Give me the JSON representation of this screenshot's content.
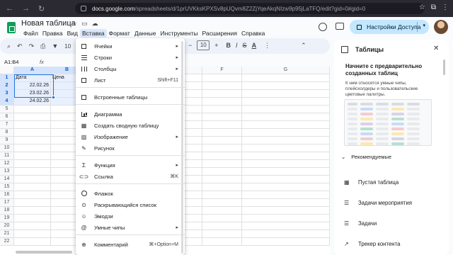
{
  "browser": {
    "back": "←",
    "forward": "→",
    "reload": "↻",
    "url_host": "docs.google.com",
    "url_path": "/spreadsheets/d/1prUVKksKPXSv8pUQvm8Z2ZjYqeAkqNIzw9p95jLaTFQ/edit?gid=0#gid=0",
    "star": "☆",
    "ext": "⧉",
    "menu": "⋮"
  },
  "app": {
    "title": "Новая таблица",
    "title_icons": [
      "☆",
      "▭",
      "☁"
    ],
    "menu": [
      "Файл",
      "Правка",
      "Вид",
      "Вставка",
      "Формат",
      "Данные",
      "Инструменты",
      "Расширения",
      "Справка"
    ],
    "active_menu_index": 3,
    "share_label": "Настройки Доступа",
    "share_caret": "▾"
  },
  "toolbar": {
    "icons": [
      "⌕",
      "↶",
      "↷",
      "⎙",
      "▼"
    ],
    "zoom": "10",
    "font_size": "10",
    "minus": "−",
    "plus": "+",
    "bold": "B",
    "italic": "I",
    "strike": "S",
    "color": "A",
    "more": "⋮",
    "collapse": "⌃"
  },
  "formula": {
    "namebox": "A1:B4",
    "fx": "fx"
  },
  "grid": {
    "columns": [
      "",
      "A",
      "B",
      "C",
      "D",
      "E",
      "F",
      "G"
    ],
    "rows": [
      {
        "num": "1",
        "cells": [
          "Дата",
          "Цена"
        ]
      },
      {
        "num": "2",
        "cells": [
          "22.02.26",
          ""
        ]
      },
      {
        "num": "3",
        "cells": [
          "23.02.26",
          ""
        ]
      },
      {
        "num": "4",
        "cells": [
          "24.02.26",
          ""
        ]
      },
      {
        "num": "5",
        "cells": [
          "",
          ""
        ]
      },
      {
        "num": "6",
        "cells": [
          "",
          ""
        ]
      },
      {
        "num": "7",
        "cells": [
          "",
          ""
        ]
      },
      {
        "num": "8",
        "cells": [
          "",
          ""
        ]
      },
      {
        "num": "9",
        "cells": [
          "",
          ""
        ]
      },
      {
        "num": "10",
        "cells": [
          "",
          ""
        ]
      },
      {
        "num": "11",
        "cells": [
          "",
          ""
        ]
      },
      {
        "num": "12",
        "cells": [
          "",
          ""
        ]
      },
      {
        "num": "13",
        "cells": [
          "",
          ""
        ]
      },
      {
        "num": "14",
        "cells": [
          "",
          ""
        ]
      },
      {
        "num": "15",
        "cells": [
          "",
          ""
        ]
      },
      {
        "num": "16",
        "cells": [
          "",
          ""
        ]
      },
      {
        "num": "17",
        "cells": [
          "",
          ""
        ]
      },
      {
        "num": "18",
        "cells": [
          "",
          ""
        ]
      },
      {
        "num": "19",
        "cells": [
          "",
          ""
        ]
      },
      {
        "num": "20",
        "cells": [
          "",
          ""
        ]
      },
      {
        "num": "21",
        "cells": [
          "",
          ""
        ]
      },
      {
        "num": "22",
        "cells": [
          "",
          ""
        ]
      }
    ]
  },
  "insert_menu": {
    "items": [
      {
        "label": "Ячейки",
        "right": "▸",
        "icon": "box-icon"
      },
      {
        "label": "Строки",
        "right": "▸",
        "icon": "rows-icon"
      },
      {
        "label": "Столбцы",
        "right": "▸",
        "icon": "columns-icon"
      },
      {
        "label": "Лист",
        "right": "Shift+F11",
        "icon": "sheet-icon"
      },
      {
        "label": "Встроенные таблицы",
        "right": "",
        "icon": "table-icon"
      },
      {
        "label": "Диаграмма",
        "right": "",
        "icon": "chart-icon"
      },
      {
        "label": "Создать сводную таблицу",
        "right": "",
        "icon": "pivot-icon"
      },
      {
        "label": "Изображение",
        "right": "▸",
        "icon": "image-icon"
      },
      {
        "label": "Рисунок",
        "right": "",
        "icon": "drawing-icon"
      },
      {
        "label": "Функция",
        "right": "▸",
        "icon": "function-icon"
      },
      {
        "label": "Ссылка",
        "right": "⌘K",
        "icon": "link-icon"
      },
      {
        "label": "Флажок",
        "right": "",
        "icon": "checkbox-icon"
      },
      {
        "label": "Раскрывающийся список",
        "right": "",
        "icon": "dropdown-icon"
      },
      {
        "label": "Эмодзи",
        "right": "",
        "icon": "emoji-icon"
      },
      {
        "label": "Умные чипы",
        "right": "▸",
        "icon": "chip-icon"
      },
      {
        "label": "Комментарий",
        "right": "⌘+Option+M",
        "icon": "comment-icon"
      }
    ],
    "glyphs": [
      "",
      "",
      "",
      "",
      "",
      "",
      "▦",
      "▨",
      "✎",
      "Σ",
      "⊂⊃",
      "",
      "⊙",
      "☺",
      "@",
      "⊕"
    ]
  },
  "panel": {
    "title": "Таблицы",
    "close": "✕",
    "heading": "Начните с предварительно созданных таблиц",
    "description": "К ним относятся умные чипы, плейсхолдеры и пользовательские цветовые палитры.",
    "section": "Рекомендуемые",
    "section_chevron": "⌄",
    "templates": [
      {
        "label": "Пустая таблица",
        "glyph": "▦"
      },
      {
        "label": "Задачи мероприятия",
        "glyph": "☰"
      },
      {
        "label": "Задачи",
        "glyph": "☰"
      },
      {
        "label": "Трекер контента",
        "glyph": "↗"
      }
    ]
  }
}
